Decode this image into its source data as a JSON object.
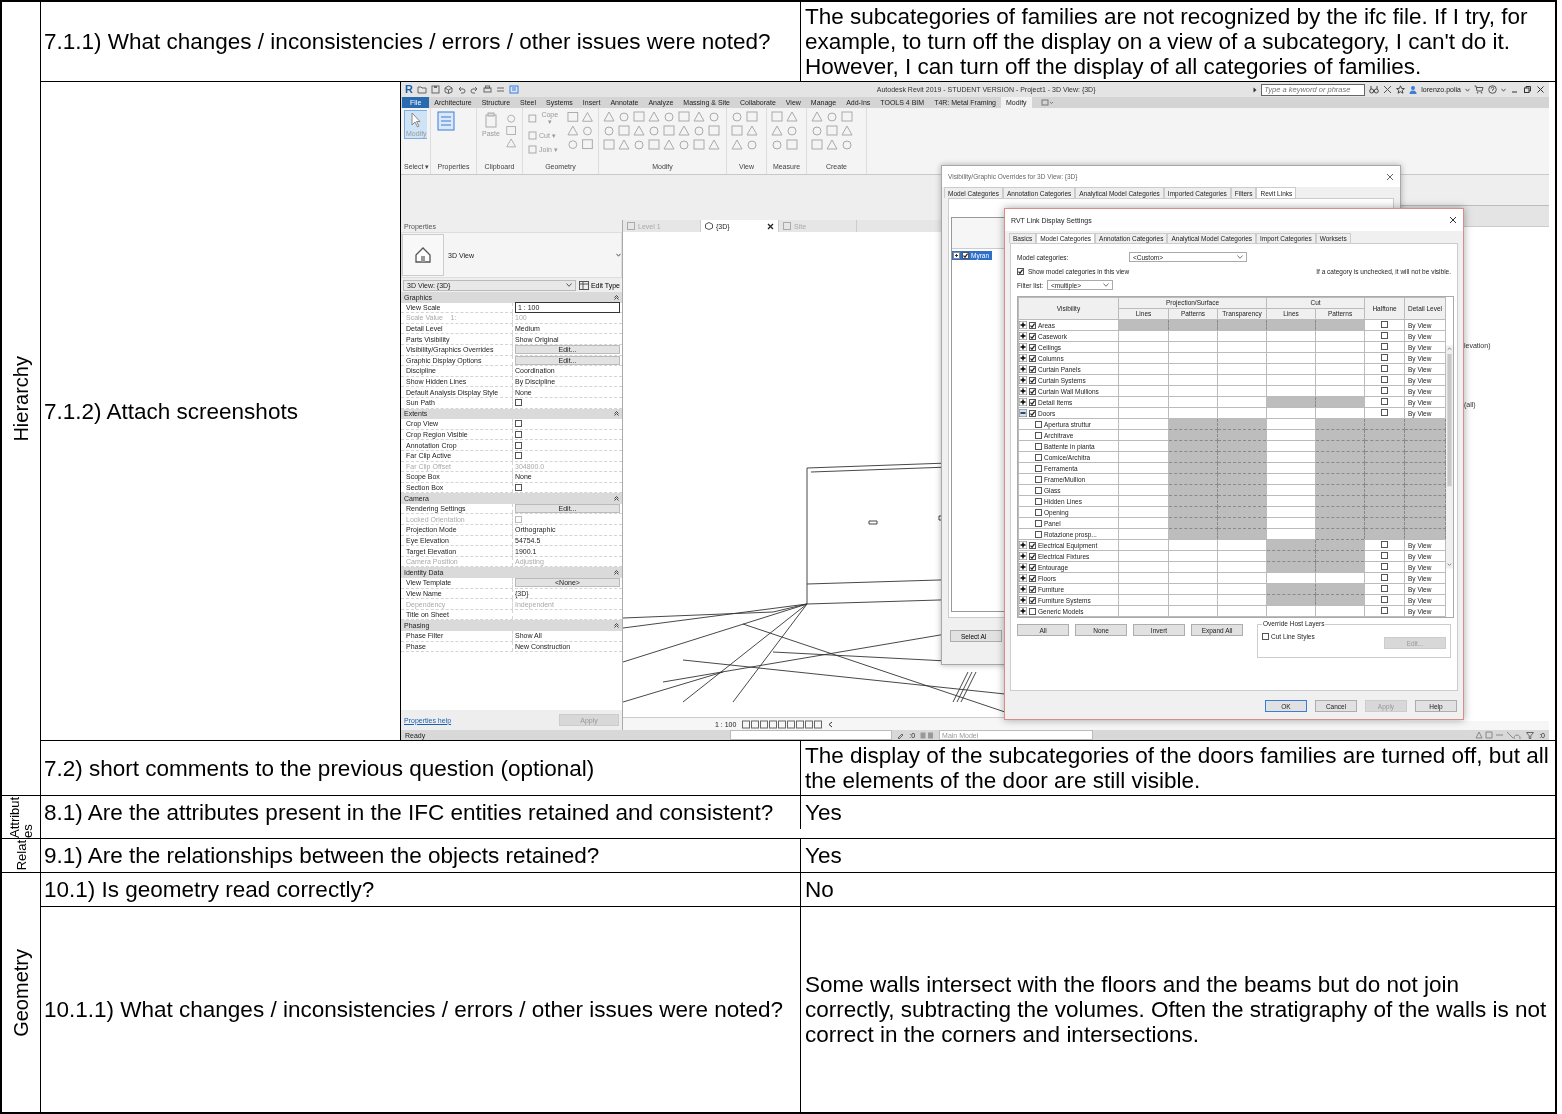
{
  "document": {
    "sections": [
      {
        "label": "Hierarchy",
        "rows": [
          {
            "kind": "qa",
            "question": "7.1.1) What changes / inconsistencies / errors / other issues were noted?",
            "answer": "The subcategories of families are not recognized by the ifc file. If I try, for example, to turn off the display on a view of a subcategory, I can't do it. However, I can turn off the display of all categories of families."
          },
          {
            "kind": "screenshot",
            "question": "7.1.2) Attach screenshots"
          },
          {
            "kind": "qa",
            "question": "7.2) short comments to the previous question (optional)",
            "answer": "The display of the subcategories of the doors families are turned off, but all the elements of the door are still visible."
          }
        ]
      },
      {
        "label": "Attributes",
        "rows": [
          {
            "kind": "qa",
            "question": "8.1) Are the attributes present in the IFC entities retained and consistent?",
            "answer": "Yes"
          }
        ]
      },
      {
        "label": "Relat",
        "rows": [
          {
            "kind": "qa",
            "question": "9.1) Are the relationships between the objects retained?",
            "answer": "Yes"
          }
        ]
      },
      {
        "label": "Geometry",
        "rows": [
          {
            "kind": "qa",
            "question": "10.1) Is geometry read correctly?",
            "answer": "No"
          },
          {
            "kind": "qa",
            "question": "10.1.1) What changes / inconsistencies / errors / other issues were noted?",
            "answer": "Some walls intersect with the floors and the beams but do not join correctly, subtracting the volumes. Often the stratigraphy of the walls is not correct in the corners and intersections."
          }
        ]
      }
    ]
  },
  "revit": {
    "logo": "R",
    "title": "Autodesk Revit 2019 - STUDENT VERSION - Project1 - 3D View: {3D}",
    "search": {
      "placeholder": "Type a keyword or phrase"
    },
    "user": "lorenzo.polia",
    "ribbon_tabs": [
      {
        "label": "File",
        "kind": "file",
        "selected": false
      },
      {
        "label": "Architecture",
        "kind": "tab",
        "selected": false
      },
      {
        "label": "Structure",
        "kind": "tab",
        "selected": false
      },
      {
        "label": "Steel",
        "kind": "tab",
        "selected": false
      },
      {
        "label": "Systems",
        "kind": "tab",
        "selected": false
      },
      {
        "label": "Insert",
        "kind": "tab",
        "selected": false
      },
      {
        "label": "Annotate",
        "kind": "tab",
        "selected": false
      },
      {
        "label": "Analyze",
        "kind": "tab",
        "selected": false
      },
      {
        "label": "Massing & Site",
        "kind": "tab",
        "selected": false
      },
      {
        "label": "Collaborate",
        "kind": "tab",
        "selected": false
      },
      {
        "label": "View",
        "kind": "tab",
        "selected": false
      },
      {
        "label": "Manage",
        "kind": "tab",
        "selected": false
      },
      {
        "label": "Add-Ins",
        "kind": "tab",
        "selected": false
      },
      {
        "label": "TOOLS 4 BIM",
        "kind": "tab",
        "selected": false
      },
      {
        "label": "T4R: Metal Framing",
        "kind": "tab",
        "selected": false
      },
      {
        "label": "Modify",
        "kind": "tab",
        "selected": true
      }
    ],
    "ribbon_panels": [
      {
        "label": "Select ▾",
        "tools": [
          {
            "label": "Modify",
            "kind": "active"
          }
        ]
      },
      {
        "label": "Properties"
      },
      {
        "label": "Clipboard",
        "tools": [
          {
            "label": "Paste",
            "kind": "large"
          }
        ]
      },
      {
        "label": "Geometry",
        "tools": [
          {
            "label": "Cope ▾",
            "kind": "small"
          },
          {
            "label": "Cut ▾",
            "kind": "small"
          },
          {
            "label": "Join ▾",
            "kind": "small"
          }
        ]
      },
      {
        "label": "Modify"
      },
      {
        "label": "View"
      },
      {
        "label": "Measure"
      },
      {
        "label": "Create"
      }
    ],
    "properties": {
      "title": "Properties",
      "type_name": "3D View",
      "instance": "3D View: {3D}",
      "edit_type": "Edit Type",
      "groups": [
        {
          "name": "Graphics",
          "rows": [
            {
              "label": "View Scale",
              "kind": "field",
              "value": "1 : 100",
              "disabled": false
            },
            {
              "label": "Scale Value    1:",
              "kind": "text",
              "value": "100",
              "disabled": true
            },
            {
              "label": "Detail Level",
              "kind": "text",
              "value": "Medium",
              "disabled": false
            },
            {
              "label": "Parts Visibility",
              "kind": "text",
              "value": "Show Original",
              "disabled": false
            },
            {
              "label": "Visibility/Graphics Overrides",
              "kind": "button",
              "value": "Edit...",
              "disabled": false
            },
            {
              "label": "Graphic Display Options",
              "kind": "button",
              "value": "Edit...",
              "disabled": false
            },
            {
              "label": "Discipline",
              "kind": "text",
              "value": "Coordination",
              "disabled": false
            },
            {
              "label": "Show Hidden Lines",
              "kind": "text",
              "value": "By Discipline",
              "disabled": false
            },
            {
              "label": "Default Analysis Display Style",
              "kind": "text",
              "value": "None",
              "disabled": false
            },
            {
              "label": "Sun Path",
              "kind": "checkbox",
              "checked": false,
              "disabled": false
            }
          ]
        },
        {
          "name": "Extents",
          "rows": [
            {
              "label": "Crop View",
              "kind": "checkbox",
              "checked": false,
              "disabled": false
            },
            {
              "label": "Crop Region Visible",
              "kind": "checkbox",
              "checked": false,
              "disabled": false
            },
            {
              "label": "Annotation Crop",
              "kind": "checkbox",
              "checked": false,
              "disabled": false
            },
            {
              "label": "Far Clip Active",
              "kind": "checkbox",
              "checked": false,
              "disabled": false
            },
            {
              "label": "Far Clip Offset",
              "kind": "text",
              "value": "304800.0",
              "disabled": true
            },
            {
              "label": "Scope Box",
              "kind": "text",
              "value": "None",
              "disabled": false
            },
            {
              "label": "Section Box",
              "kind": "checkbox",
              "checked": false,
              "disabled": false
            }
          ]
        },
        {
          "name": "Camera",
          "rows": [
            {
              "label": "Rendering Settings",
              "kind": "button",
              "value": "Edit...",
              "disabled": false
            },
            {
              "label": "Locked Orientation",
              "kind": "checkbox",
              "checked": false,
              "disabled": true
            },
            {
              "label": "Projection Mode",
              "kind": "text",
              "value": "Orthographic",
              "disabled": false
            },
            {
              "label": "Eye Elevation",
              "kind": "text",
              "value": "54754.5",
              "disabled": false
            },
            {
              "label": "Target Elevation",
              "kind": "text",
              "value": "1900.1",
              "disabled": false
            },
            {
              "label": "Camera Position",
              "kind": "text",
              "value": "Adjusting",
              "disabled": true
            }
          ]
        },
        {
          "name": "Identity Data",
          "rows": [
            {
              "label": "View Template",
              "kind": "button",
              "value": "<None>",
              "disabled": false
            },
            {
              "label": "View Name",
              "kind": "text",
              "value": "{3D}",
              "disabled": false
            },
            {
              "label": "Dependency",
              "kind": "text",
              "value": "Independent",
              "disabled": true
            },
            {
              "label": "Title on Sheet",
              "kind": "text",
              "disabled": false
            }
          ]
        },
        {
          "name": "Phasing",
          "rows": [
            {
              "label": "Phase Filter",
              "kind": "text",
              "value": "Show All",
              "disabled": false
            },
            {
              "label": "Phase",
              "kind": "text",
              "value": "New Construction",
              "disabled": false
            }
          ]
        }
      ],
      "help": "Properties help",
      "apply": "Apply"
    },
    "view_tabs": [
      {
        "label": "Level 1",
        "selected": false
      },
      {
        "label": "{3D}",
        "selected": true
      },
      {
        "label": "Site",
        "selected": false
      }
    ],
    "view_scale": "1 : 100",
    "status": {
      "text": "Ready",
      "workset_count": ":0",
      "model": "Main Model",
      "filter_count": ":0"
    },
    "background_labels": [
      "levation)",
      "(all)"
    ],
    "vg_dialog": {
      "title": "Visibility/Graphic Overrides for 3D View: {3D}",
      "tabs": [
        {
          "label": "Model Categories",
          "selected": false
        },
        {
          "label": "Annotation Categories",
          "selected": false
        },
        {
          "label": "Analytical Model Categories",
          "selected": false
        },
        {
          "label": "Imported Categories",
          "selected": false
        },
        {
          "label": "Filters",
          "selected": false
        },
        {
          "label": "Revit Links",
          "selected": true
        }
      ],
      "links": [
        {
          "name": "Myran",
          "checked": true,
          "selected": true
        }
      ],
      "select_all": "Select Al"
    },
    "link_dialog": {
      "title": "RVT Link Display Settings",
      "tabs": [
        {
          "label": "Basics",
          "selected": false
        },
        {
          "label": "Model Categories",
          "selected": true
        },
        {
          "label": "Annotation Categories",
          "selected": false
        },
        {
          "label": "Analytical Model Categories",
          "selected": false
        },
        {
          "label": "Import Categories",
          "selected": false
        },
        {
          "label": "Worksets",
          "selected": false
        }
      ],
      "model_categories_label": "Model categories:",
      "model_categories_value": "<Custom>",
      "show_categories": {
        "label": "Show model categories in this view",
        "checked": true
      },
      "filter_label": "Filter list:",
      "filter_value": "<multiple>",
      "note": "If a category is unchecked, it will not be visible.",
      "columns": {
        "visibility": "Visibility",
        "projection": "Projection/Surface",
        "projection_lines": "Lines",
        "projection_patterns": "Patterns",
        "transparency": "Transparency",
        "cut": "Cut",
        "cut_lines": "Lines",
        "cut_patterns": "Patterns",
        "halftone": "Halftone",
        "detail_level": "Detail Level"
      },
      "rows": [
        {
          "name": "Areas",
          "kind": "category",
          "checked": true,
          "expanded": false,
          "greyed": [
            true,
            true,
            true,
            true,
            true,
            false,
            false
          ],
          "halftone": false,
          "detail": "By View"
        },
        {
          "name": "Casework",
          "kind": "category",
          "checked": true,
          "expanded": false,
          "greyed": [
            false,
            false,
            false,
            false,
            false,
            false,
            false
          ],
          "halftone": false,
          "detail": "By View"
        },
        {
          "name": "Ceilings",
          "kind": "category",
          "checked": true,
          "expanded": false,
          "greyed": [
            false,
            false,
            false,
            false,
            false,
            false,
            false
          ],
          "halftone": false,
          "detail": "By View"
        },
        {
          "name": "Columns",
          "kind": "category",
          "checked": true,
          "expanded": false,
          "greyed": [
            false,
            false,
            false,
            false,
            false,
            false,
            false
          ],
          "halftone": false,
          "detail": "By View"
        },
        {
          "name": "Curtain Panels",
          "kind": "category",
          "checked": true,
          "expanded": false,
          "greyed": [
            false,
            false,
            false,
            false,
            false,
            false,
            false
          ],
          "halftone": false,
          "detail": "By View"
        },
        {
          "name": "Curtain Systems",
          "kind": "category",
          "checked": true,
          "expanded": false,
          "greyed": [
            false,
            false,
            false,
            false,
            false,
            false,
            false
          ],
          "halftone": false,
          "detail": "By View"
        },
        {
          "name": "Curtain Wall Mullions",
          "kind": "category",
          "checked": true,
          "expanded": false,
          "greyed": [
            false,
            false,
            false,
            false,
            false,
            false,
            false
          ],
          "halftone": false,
          "detail": "By View"
        },
        {
          "name": "Detail Items",
          "kind": "category",
          "checked": true,
          "expanded": false,
          "greyed": [
            false,
            false,
            false,
            true,
            true,
            false,
            false
          ],
          "halftone": false,
          "detail": "By View"
        },
        {
          "name": "Doors",
          "kind": "category",
          "checked": true,
          "expanded": true,
          "greyed": [
            false,
            false,
            false,
            false,
            false,
            false,
            false
          ],
          "halftone": false,
          "detail": "By View"
        },
        {
          "name": "Apertura struttur",
          "kind": "subcategory",
          "checked": false,
          "greyed": [
            false,
            true,
            true,
            false,
            true,
            true,
            true
          ]
        },
        {
          "name": "Architrave",
          "kind": "subcategory",
          "checked": false,
          "greyed": [
            false,
            true,
            true,
            false,
            true,
            true,
            true
          ]
        },
        {
          "name": "Battente in pianta",
          "kind": "subcategory",
          "checked": false,
          "greyed": [
            false,
            true,
            true,
            false,
            true,
            true,
            true
          ]
        },
        {
          "name": "Comice/Architra",
          "kind": "subcategory",
          "checked": false,
          "greyed": [
            false,
            true,
            true,
            false,
            true,
            true,
            true
          ]
        },
        {
          "name": "Ferramenta",
          "kind": "subcategory",
          "checked": false,
          "greyed": [
            false,
            true,
            true,
            false,
            true,
            true,
            true
          ]
        },
        {
          "name": "Frame/Mullion",
          "kind": "subcategory",
          "checked": false,
          "greyed": [
            false,
            true,
            true,
            false,
            true,
            true,
            true
          ]
        },
        {
          "name": "Glass",
          "kind": "subcategory",
          "checked": false,
          "greyed": [
            false,
            true,
            true,
            false,
            true,
            true,
            true
          ]
        },
        {
          "name": "Hidden Lines",
          "kind": "subcategory",
          "checked": false,
          "greyed": [
            false,
            true,
            true,
            false,
            true,
            true,
            true
          ]
        },
        {
          "name": "Opening",
          "kind": "subcategory",
          "checked": false,
          "greyed": [
            false,
            true,
            true,
            false,
            true,
            true,
            true
          ]
        },
        {
          "name": "Panel",
          "kind": "subcategory",
          "checked": false,
          "greyed": [
            false,
            true,
            true,
            false,
            true,
            true,
            true
          ]
        },
        {
          "name": "Rotazione prosp...",
          "kind": "subcategory",
          "checked": false,
          "greyed": [
            false,
            true,
            true,
            false,
            true,
            true,
            true
          ]
        },
        {
          "name": "Electrical Equipment",
          "kind": "category",
          "checked": true,
          "expanded": false,
          "greyed": [
            false,
            false,
            false,
            true,
            true,
            false,
            false
          ],
          "halftone": false,
          "detail": "By View"
        },
        {
          "name": "Electrical Fixtures",
          "kind": "category",
          "checked": true,
          "expanded": false,
          "greyed": [
            false,
            false,
            false,
            true,
            true,
            false,
            false
          ],
          "halftone": false,
          "detail": "By View"
        },
        {
          "name": "Entourage",
          "kind": "category",
          "checked": true,
          "expanded": false,
          "greyed": [
            false,
            false,
            false,
            true,
            true,
            false,
            false
          ],
          "halftone": false,
          "detail": "By View"
        },
        {
          "name": "Floors",
          "kind": "category",
          "checked": true,
          "expanded": false,
          "greyed": [
            false,
            false,
            false,
            false,
            false,
            false,
            false
          ],
          "halftone": false,
          "detail": "By View"
        },
        {
          "name": "Furniture",
          "kind": "category",
          "checked": true,
          "expanded": false,
          "greyed": [
            false,
            false,
            false,
            true,
            true,
            false,
            false
          ],
          "halftone": false,
          "detail": "By View"
        },
        {
          "name": "Furniture Systems",
          "kind": "category",
          "checked": true,
          "expanded": false,
          "greyed": [
            false,
            false,
            false,
            true,
            true,
            false,
            false
          ],
          "halftone": false,
          "detail": "By View"
        },
        {
          "name": "Generic Models",
          "kind": "category",
          "checked": false,
          "expanded": false,
          "greyed": [
            false,
            false,
            false,
            false,
            false,
            false,
            false
          ],
          "halftone": false,
          "detail": "By View"
        }
      ],
      "buttons": [
        "All",
        "None",
        "Invert",
        "Expand All"
      ],
      "override": {
        "title": "Override Host Layers",
        "cut_line_styles": {
          "label": "Cut Line Styles",
          "checked": false
        },
        "edit": {
          "label": "Edit...",
          "disabled": true
        }
      },
      "footer_buttons": [
        {
          "label": "OK",
          "default": true,
          "disabled": false
        },
        {
          "label": "Cancel",
          "default": false,
          "disabled": false
        },
        {
          "label": "Apply",
          "default": false,
          "disabled": true
        },
        {
          "label": "Help",
          "default": false,
          "disabled": false
        }
      ]
    }
  }
}
